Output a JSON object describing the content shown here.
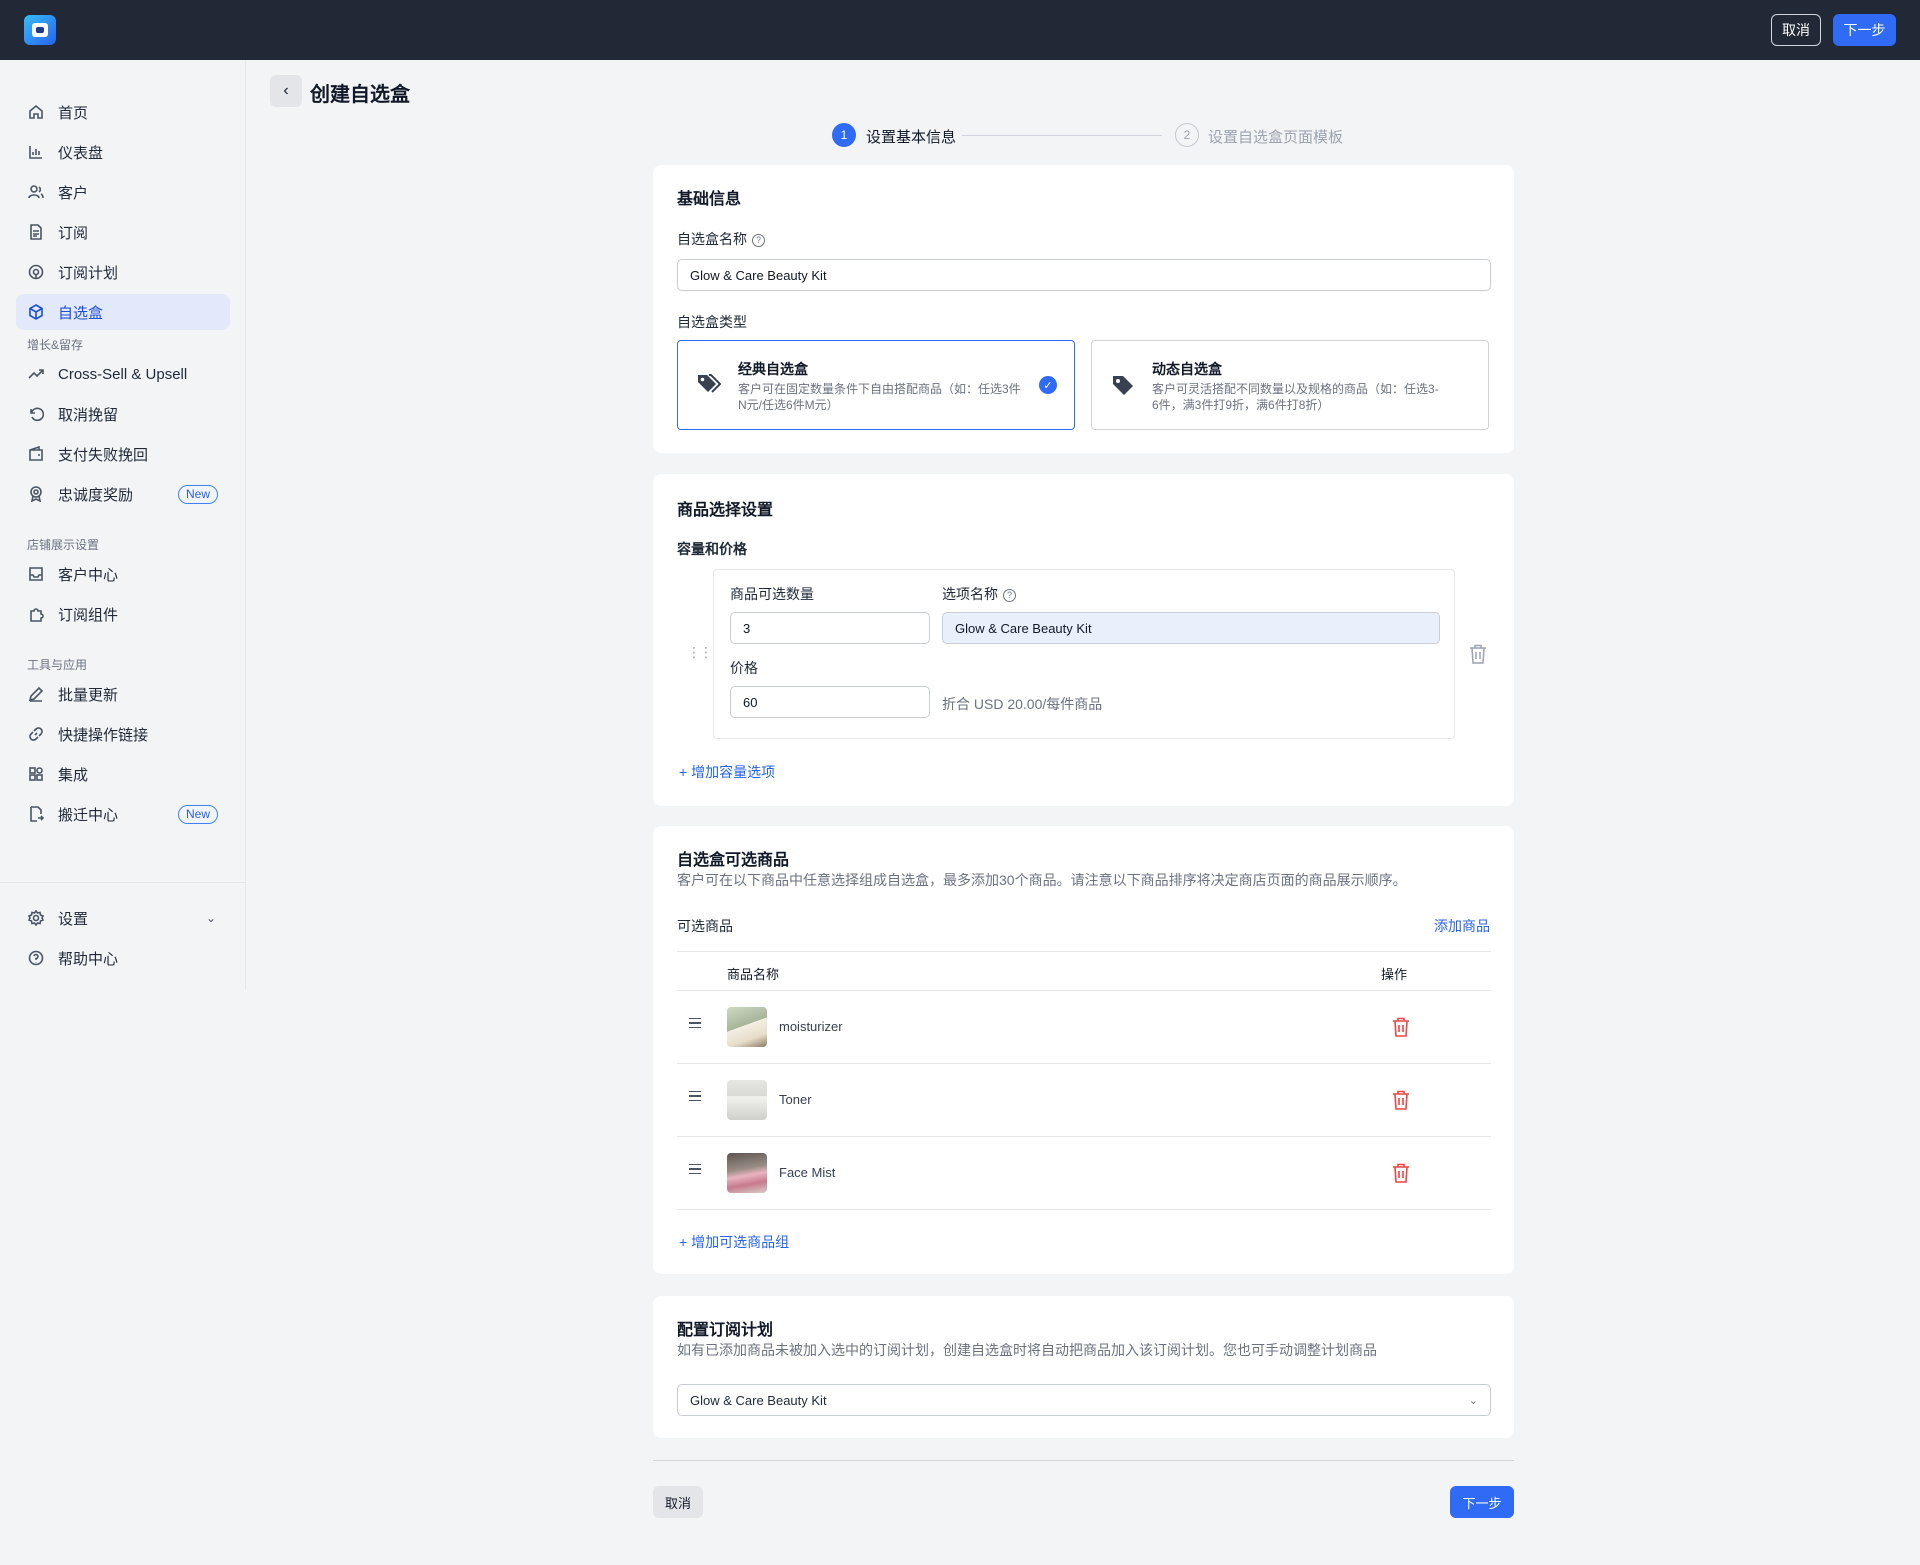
{
  "header": {
    "logo_icon": "app-logo-icon",
    "cancel_label": "取消",
    "next_label": "下一步"
  },
  "sidebar": {
    "items_main": [
      {
        "label": "首页",
        "icon": "home-icon"
      },
      {
        "label": "仪表盘",
        "icon": "bar-chart-icon"
      },
      {
        "label": "客户",
        "icon": "users-icon"
      },
      {
        "label": "订阅",
        "icon": "document-icon"
      },
      {
        "label": "订阅计划",
        "icon": "plan-icon"
      },
      {
        "label": "自选盒",
        "icon": "box-icon",
        "active": true
      }
    ],
    "group_growth": "增长&留存",
    "items_growth": [
      {
        "label": "Cross-Sell & Upsell",
        "icon": "trend-up-icon"
      },
      {
        "label": "取消挽留",
        "icon": "undo-icon"
      },
      {
        "label": "支付失败挽回",
        "icon": "wallet-icon"
      },
      {
        "label": "忠诚度奖励",
        "icon": "award-icon",
        "badge": "New"
      }
    ],
    "group_store": "店铺展示设置",
    "items_store": [
      {
        "label": "客户中心",
        "icon": "inbox-icon"
      },
      {
        "label": "订阅组件",
        "icon": "puzzle-icon"
      }
    ],
    "group_tools": "工具与应用",
    "items_tools": [
      {
        "label": "批量更新",
        "icon": "edit-icon"
      },
      {
        "label": "快捷操作链接",
        "icon": "link-icon"
      },
      {
        "label": "集成",
        "icon": "apps-icon"
      },
      {
        "label": "搬迁中心",
        "icon": "migrate-icon",
        "badge": "New"
      }
    ],
    "items_bottom": [
      {
        "label": "设置",
        "icon": "gear-icon"
      },
      {
        "label": "帮助中心",
        "icon": "help-circle-icon"
      }
    ]
  },
  "page": {
    "title": "创建自选盒"
  },
  "steps": [
    {
      "number": "1",
      "label": "设置基本信息",
      "state": "active"
    },
    {
      "number": "2",
      "label": "设置自选盒页面模板",
      "state": "pending"
    }
  ],
  "basic_info": {
    "title": "基础信息",
    "name_label": "自选盒名称",
    "name_value": "Glow & Care Beauty Kit",
    "type_label": "自选盒类型",
    "types": [
      {
        "title": "经典自选盒",
        "desc": "客户可在固定数量条件下自由搭配商品（如：任选3件N元/任选6件M元）",
        "selected": true
      },
      {
        "title": "动态自选盒",
        "desc": "客户可灵活搭配不同数量以及规格的商品（如：任选3-6件，满3件打9折，满6件打8折）",
        "selected": false
      }
    ]
  },
  "selection": {
    "title": "商品选择设置",
    "subtitle": "容量和价格",
    "qty_label": "商品可选数量",
    "qty_value": "3",
    "option_label": "选项名称",
    "option_value": "Glow & Care Beauty Kit",
    "price_label": "价格",
    "price_value": "60",
    "price_note": "折合 USD 20.00/每件商品",
    "add_option": "增加容量选项"
  },
  "products": {
    "title": "自选盒可选商品",
    "desc": "客户可在以下商品中任意选择组成自选盒，最多添加30个商品。请注意以下商品排序将决定商店页面的商品展示顺序。",
    "list_label": "可选商品",
    "add_product": "添加商品",
    "col_name": "商品名称",
    "col_action": "操作",
    "rows": [
      {
        "name": "moisturizer"
      },
      {
        "name": "Toner"
      },
      {
        "name": "Face Mist"
      }
    ],
    "add_group": "增加可选商品组"
  },
  "plan": {
    "title": "配置订阅计划",
    "desc": "如有已添加商品未被加入选中的订阅计划，创建自选盒时将自动把商品加入该订阅计划。您也可手动调整计划商品",
    "selected": "Glow & Care Beauty Kit"
  },
  "footer": {
    "cancel_label": "取消",
    "next_label": "下一步"
  },
  "colors": {
    "primary": "#2f6bf5",
    "topbar": "#212836",
    "danger": "#ef4444"
  }
}
